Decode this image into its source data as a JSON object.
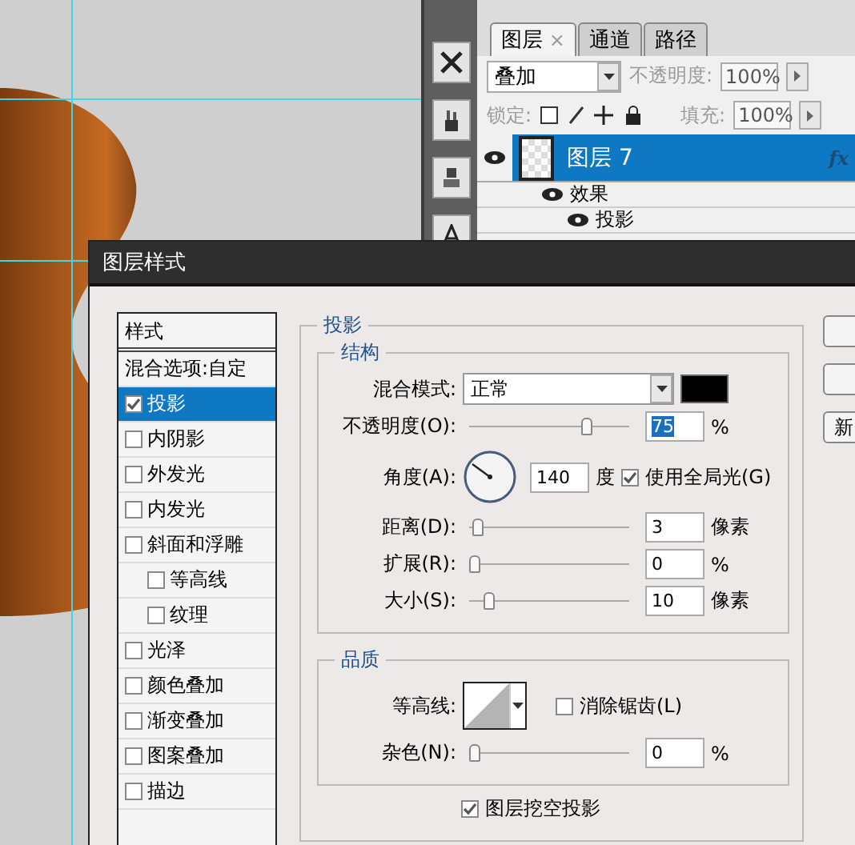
{
  "layers_panel": {
    "tabs": [
      {
        "label": "图层",
        "selected": true,
        "close": "×"
      },
      {
        "label": "通道",
        "selected": false
      },
      {
        "label": "路径",
        "selected": false
      }
    ],
    "blend_mode": "叠加",
    "opacity_label": "不透明度:",
    "opacity": "100%",
    "lock_label": "锁定:",
    "fill_label": "填充:",
    "fill": "100%",
    "layers": [
      {
        "name": "图层 7",
        "selected": true,
        "fx": "fx",
        "children": [
          {
            "name": "效果",
            "children": [
              {
                "name": "投影"
              }
            ]
          }
        ]
      }
    ]
  },
  "dialog": {
    "title": "图层样式",
    "styles_header": "样式",
    "styles": [
      {
        "label": "混合选项:自定",
        "kind": "header",
        "selected": false
      },
      {
        "label": "投影",
        "kind": "check",
        "checked": true,
        "selected": true
      },
      {
        "label": "内阴影",
        "kind": "check",
        "checked": false,
        "selected": false
      },
      {
        "label": "外发光",
        "kind": "check",
        "checked": false,
        "selected": false
      },
      {
        "label": "内发光",
        "kind": "check",
        "checked": false,
        "selected": false
      },
      {
        "label": "斜面和浮雕",
        "kind": "check",
        "checked": false,
        "selected": false,
        "children": [
          {
            "label": "等高线",
            "kind": "check",
            "checked": false,
            "selected": false
          },
          {
            "label": "纹理",
            "kind": "check",
            "checked": false,
            "selected": false
          }
        ]
      },
      {
        "label": "光泽",
        "kind": "check",
        "checked": false,
        "selected": false
      },
      {
        "label": "颜色叠加",
        "kind": "check",
        "checked": false,
        "selected": false
      },
      {
        "label": "渐变叠加",
        "kind": "check",
        "checked": false,
        "selected": false
      },
      {
        "label": "图案叠加",
        "kind": "check",
        "checked": false,
        "selected": false
      },
      {
        "label": "描边",
        "kind": "check",
        "checked": false,
        "selected": false
      }
    ],
    "section_title": "投影",
    "structure": {
      "title": "结构",
      "blend_label": "混合模式:",
      "blend_value": "正常",
      "opacity": {
        "label": "不透明度(O):",
        "level": 0.75,
        "value": "75",
        "unit": "%"
      },
      "angle": {
        "label": "角度(A):",
        "value": "140",
        "unit": "度",
        "global_light": {
          "label": "使用全局光(G)",
          "checked": true
        }
      },
      "sliders": [
        {
          "label": "距离(D):",
          "level": 0.02,
          "value": "3",
          "unit": "像素"
        },
        {
          "label": "扩展(R):",
          "level": 0,
          "value": "0",
          "unit": "%"
        },
        {
          "label": "大小(S):",
          "level": 0.1,
          "value": "10",
          "unit": "像素"
        }
      ]
    },
    "quality": {
      "title": "品质",
      "contour_label": "等高线:",
      "antialias": {
        "label": "消除锯齿(L)",
        "checked": false
      },
      "noise": {
        "label": "杂色(N):",
        "level": 0,
        "value": "0",
        "unit": "%"
      }
    },
    "knockout": {
      "label": "图层挖空投影",
      "checked": true
    },
    "buttons": [
      {
        "kind": "blank"
      },
      {
        "kind": "blank"
      },
      {
        "kind": "text",
        "label": "新"
      }
    ]
  }
}
